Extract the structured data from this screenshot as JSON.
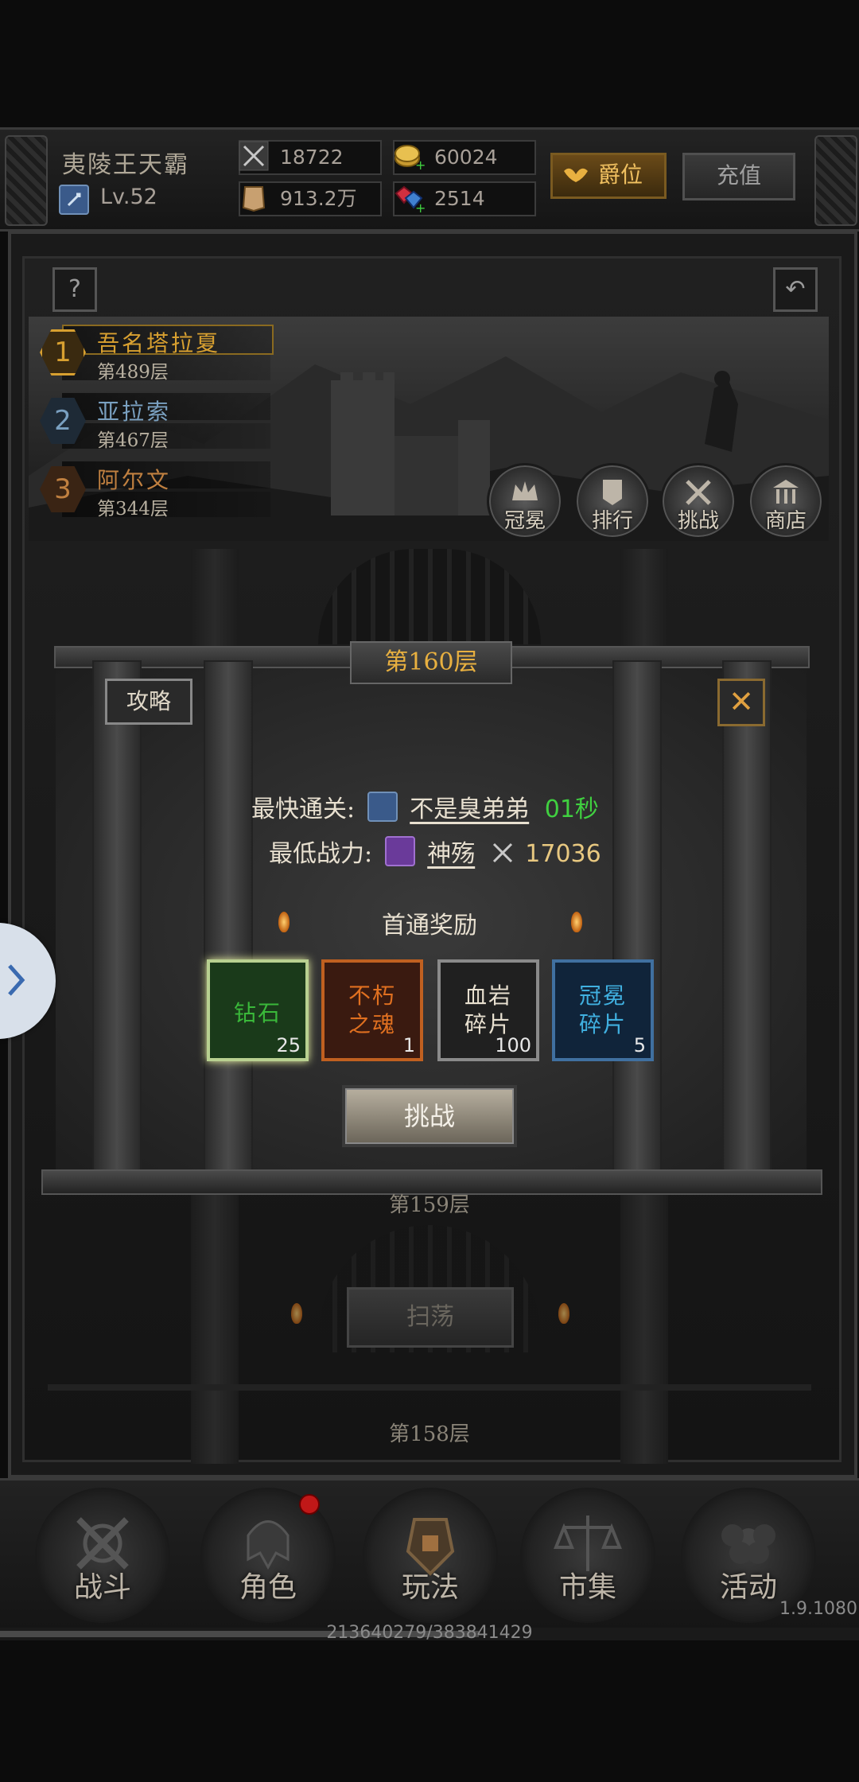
{
  "player": {
    "name": "夷陵王天霸",
    "level": "Lv.52"
  },
  "stats": {
    "power": "18722",
    "gold": "60024",
    "wealth": "913.2万",
    "gems": "2514"
  },
  "buttons": {
    "title": "爵位",
    "recharge": "充值",
    "help": "?",
    "back": "↶"
  },
  "leaderboard": [
    {
      "rank": "1",
      "name": "吾名塔拉夏",
      "floor": "第489层",
      "color": "#d8a030"
    },
    {
      "rank": "2",
      "name": "亚拉索",
      "floor": "第467层",
      "color": "#7aa0c0"
    },
    {
      "rank": "3",
      "name": "阿尔文",
      "floor": "第344层",
      "color": "#c08040"
    }
  ],
  "banner_buttons": [
    {
      "label": "冠冕",
      "icon": "crown-icon"
    },
    {
      "label": "排行",
      "icon": "banner-rank-icon"
    },
    {
      "label": "挑战",
      "icon": "swords-icon"
    },
    {
      "label": "商店",
      "icon": "shop-icon"
    }
  ],
  "dialog": {
    "floor_title": "第160层",
    "guide": "攻略",
    "close": "✕",
    "fastest_label": "最快通关:",
    "fastest_player": "不是臭弟弟",
    "fastest_time": "01秒",
    "lowest_label": "最低战力:",
    "lowest_player": "神殇",
    "lowest_power": "17036",
    "reward_title": "首通奖励",
    "rewards": [
      {
        "name": "钻石",
        "count": "25",
        "color": "#3ab83a",
        "border": "#b8d090"
      },
      {
        "name": "不朽之魂",
        "count": "1",
        "color": "#e07020",
        "border": "#c06020"
      },
      {
        "name": "血岩碎片",
        "count": "100",
        "color": "#e8e0d0",
        "border": "#8a8a8a"
      },
      {
        "name": "冠冕碎片",
        "count": "5",
        "color": "#40b0e0",
        "border": "#4070a0"
      }
    ],
    "challenge": "挑战"
  },
  "floors": {
    "below1": "第159层",
    "below2": "第158层",
    "sweep": "扫荡"
  },
  "bottom_nav": [
    {
      "label": "战斗",
      "icon": "battle-emblem-icon"
    },
    {
      "label": "角色",
      "icon": "helmet-emblem-icon"
    },
    {
      "label": "玩法",
      "icon": "gameplay-emblem-icon"
    },
    {
      "label": "市集",
      "icon": "scales-emblem-icon"
    },
    {
      "label": "活动",
      "icon": "flower-emblem-icon"
    }
  ],
  "version": "1.9.1080",
  "exp": {
    "text": "213640279/383841429",
    "fraction": 0.557
  }
}
